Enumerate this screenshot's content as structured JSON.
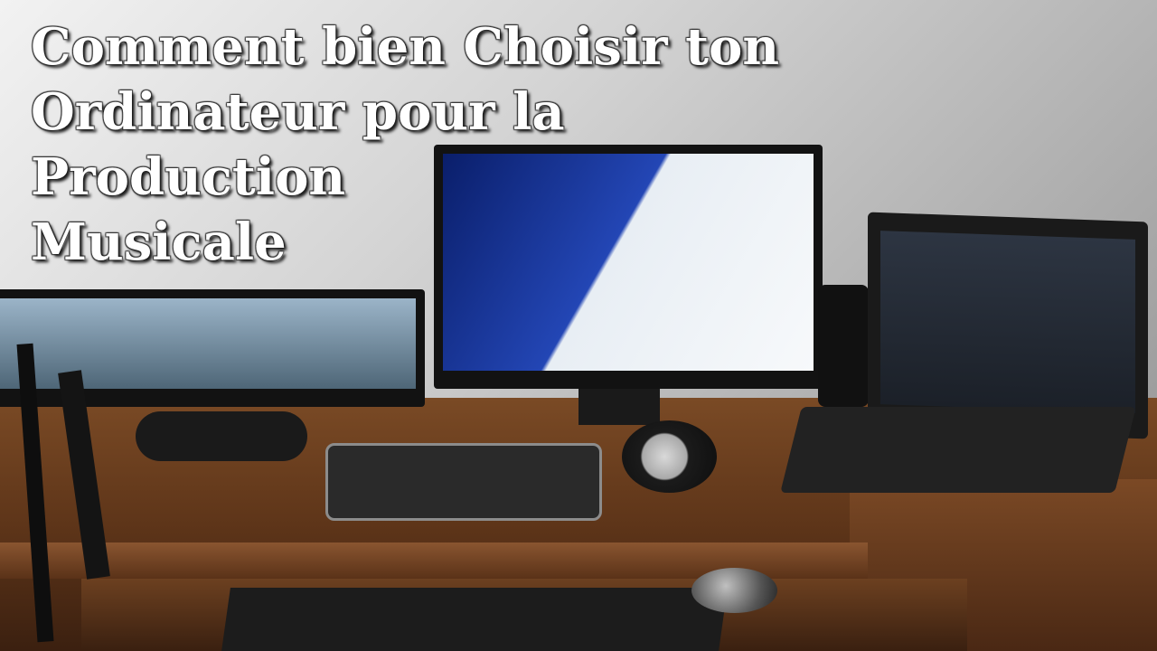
{
  "title": {
    "lines": [
      "Comment bien Choisir ton",
      "Ordinateur pour la",
      "Production",
      "Musicale"
    ]
  },
  "colors": {
    "title_text": "#ffffff",
    "title_shadow": "#1a1a1a"
  }
}
